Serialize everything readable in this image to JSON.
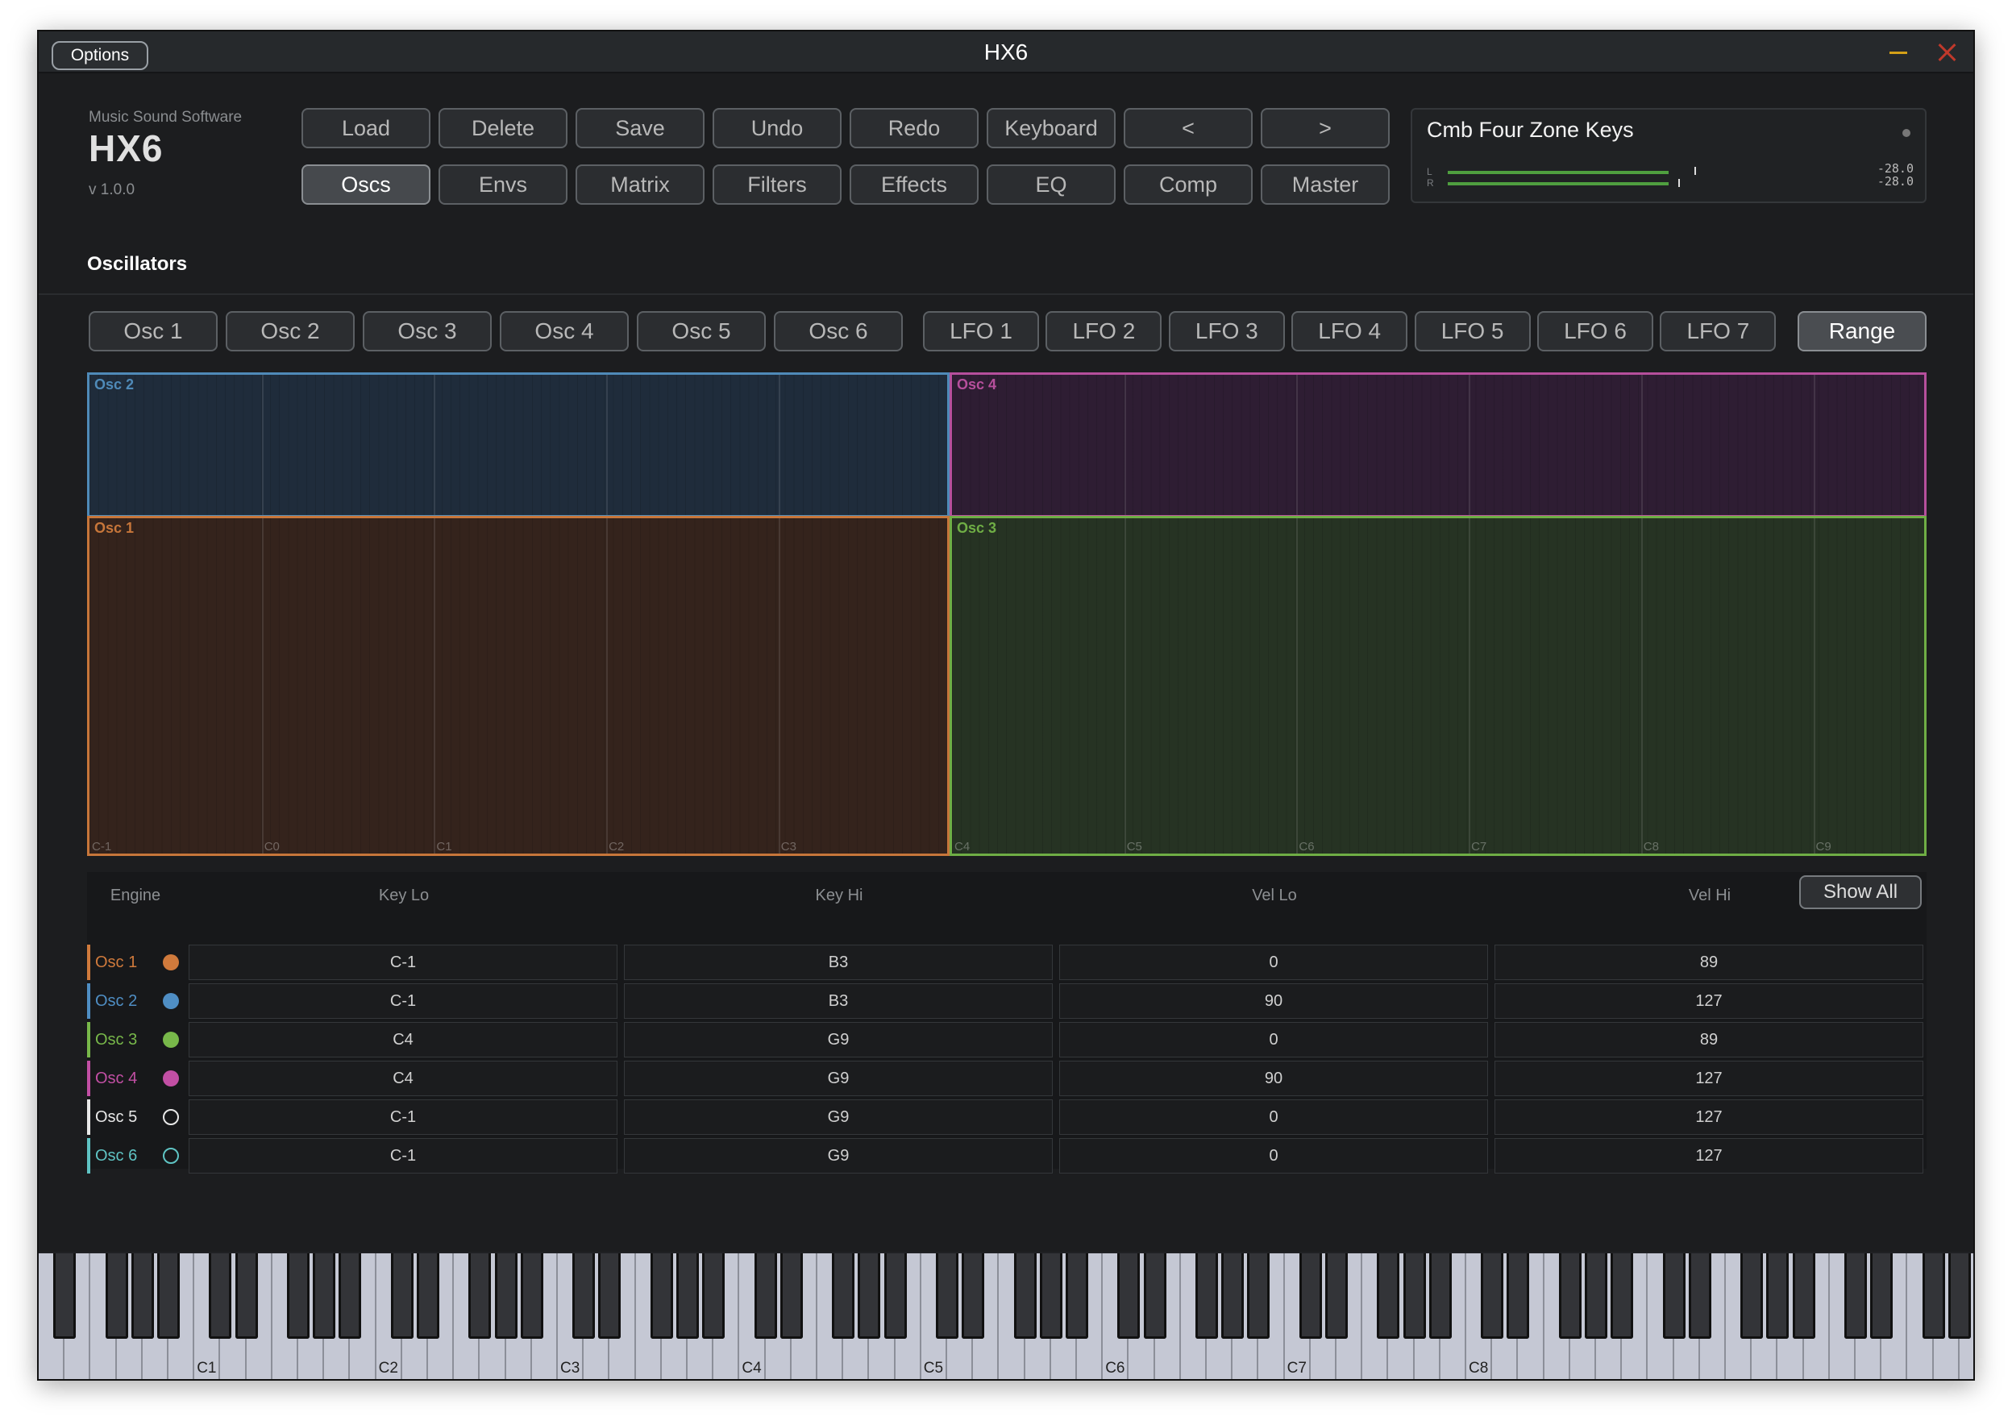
{
  "window": {
    "title": "HX6",
    "options_label": "Options"
  },
  "brand": {
    "company": "Music Sound Software",
    "logo": "HX6",
    "version": "v 1.0.0"
  },
  "toolbar": {
    "row1": [
      "Load",
      "Delete",
      "Save",
      "Undo",
      "Redo",
      "Keyboard",
      "<",
      ">"
    ],
    "row2": [
      "Oscs",
      "Envs",
      "Matrix",
      "Filters",
      "Effects",
      "EQ",
      "Comp",
      "Master"
    ],
    "active": "Oscs"
  },
  "preset": {
    "name": "Cmb Four Zone Keys",
    "meter": {
      "left_label": "L",
      "right_label": "R",
      "left_value": "-28.0",
      "right_value": "-28.0",
      "left_level": 0.76,
      "right_level": 0.76
    }
  },
  "section": {
    "title": "Oscillators"
  },
  "page_tabs": {
    "osc": [
      "Osc 1",
      "Osc 2",
      "Osc 3",
      "Osc 4",
      "Osc 5",
      "Osc 6"
    ],
    "lfo": [
      "LFO 1",
      "LFO 2",
      "LFO 3",
      "LFO 4",
      "LFO 5",
      "LFO 6",
      "LFO 7"
    ],
    "range": "Range"
  },
  "zones": {
    "osc2": {
      "label": "Osc 2",
      "color": "#4f8ab8",
      "fill": "#1f2c3b"
    },
    "osc4": {
      "label": "Osc 4",
      "color": "#b64f9c",
      "fill": "#2e1d33"
    },
    "osc1": {
      "label": "Osc 1",
      "color": "#c7763a",
      "fill": "#34231c"
    },
    "osc3": {
      "label": "Osc 3",
      "color": "#6fae45",
      "fill": "#263323"
    },
    "octave_labels": [
      "C-1",
      "C0",
      "C1",
      "C2",
      "C3",
      "C4",
      "C5",
      "C6",
      "C7",
      "C8",
      "C9"
    ]
  },
  "table": {
    "headers": [
      "Engine",
      "Key Lo",
      "Key Hi",
      "Vel Lo",
      "Vel Hi"
    ],
    "show_all": "Show All",
    "rows": [
      {
        "engine": "Osc 1",
        "color": "#d07a3c",
        "filled": true,
        "key_lo": "C-1",
        "key_hi": "B3",
        "vel_lo": "0",
        "vel_hi": "89"
      },
      {
        "engine": "Osc 2",
        "color": "#4f8ec4",
        "filled": true,
        "key_lo": "C-1",
        "key_hi": "B3",
        "vel_lo": "90",
        "vel_hi": "127"
      },
      {
        "engine": "Osc 3",
        "color": "#78b84a",
        "filled": true,
        "key_lo": "C4",
        "key_hi": "G9",
        "vel_lo": "0",
        "vel_hi": "89"
      },
      {
        "engine": "Osc 4",
        "color": "#c24fa4",
        "filled": true,
        "key_lo": "C4",
        "key_hi": "G9",
        "vel_lo": "90",
        "vel_hi": "127"
      },
      {
        "engine": "Osc 5",
        "color": "#e8e8e8",
        "filled": false,
        "key_lo": "C-1",
        "key_hi": "G9",
        "vel_lo": "0",
        "vel_hi": "127"
      },
      {
        "engine": "Osc 6",
        "color": "#5fc4c4",
        "filled": false,
        "key_lo": "C-1",
        "key_hi": "G9",
        "vel_lo": "0",
        "vel_hi": "127"
      }
    ]
  },
  "keyboard": {
    "labels": [
      "C1",
      "C2",
      "C3",
      "C4",
      "C5",
      "C6",
      "C7",
      "C8"
    ]
  }
}
